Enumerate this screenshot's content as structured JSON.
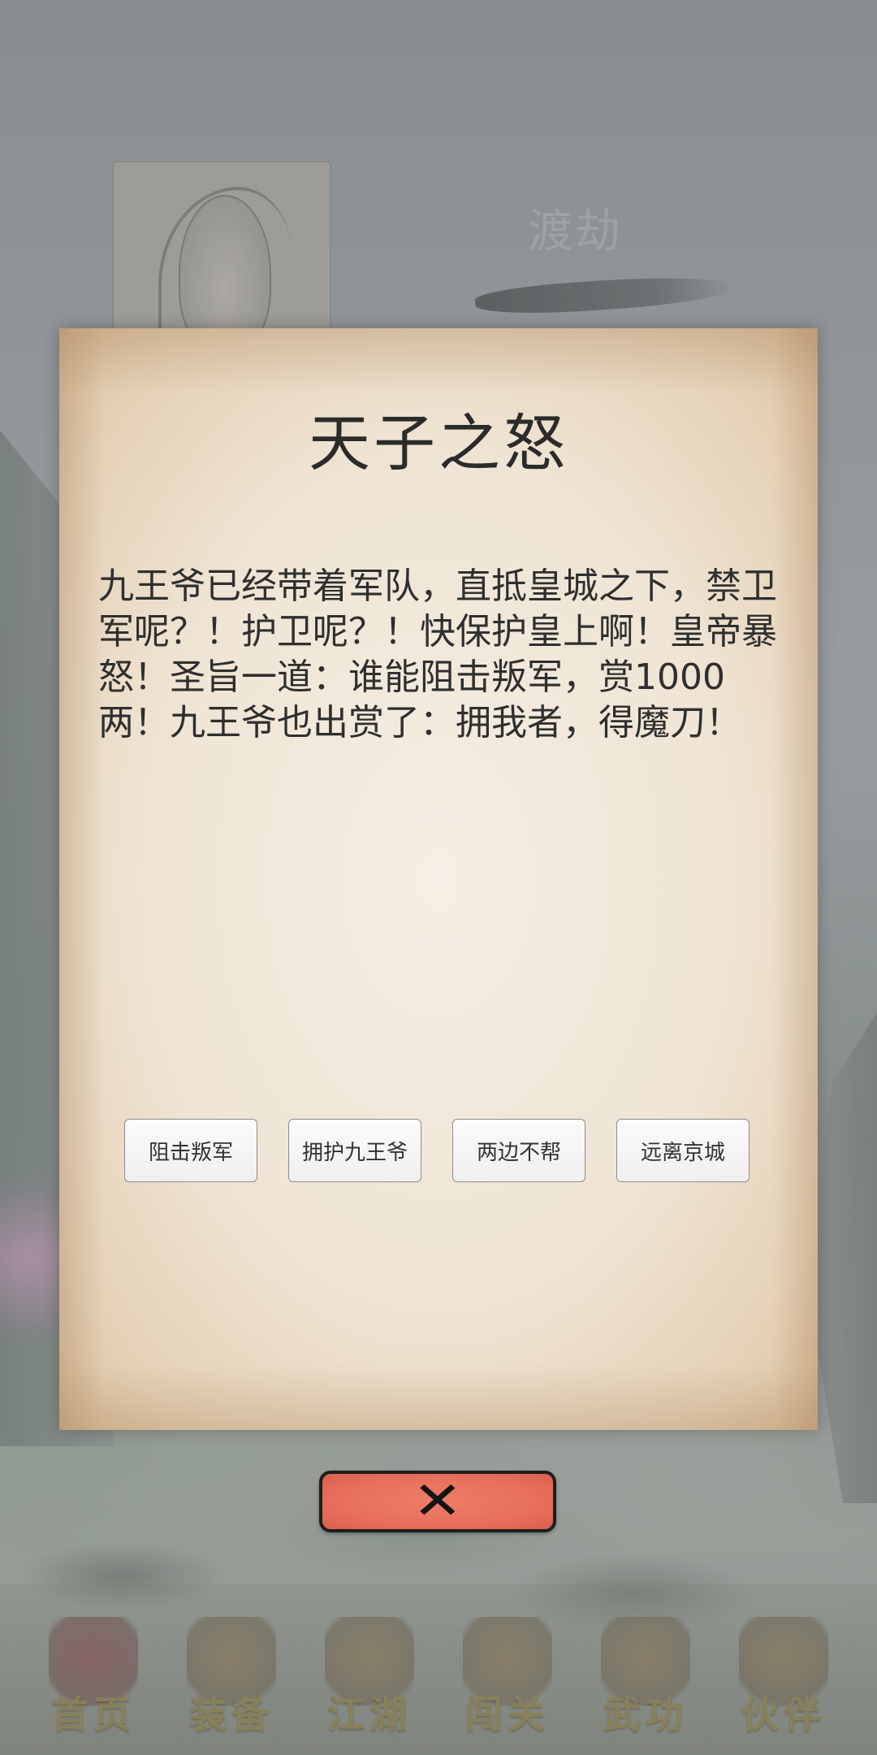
{
  "background": {
    "stage_title": "渡劫"
  },
  "dialog": {
    "title": "天子之怒",
    "body": "九王爷已经带着军队，直抵皇城之下，禁卫军呢？！护卫呢？！快保护皇上啊！皇帝暴怒！圣旨一道：谁能阻击叛军，赏1000两！九王爷也出赏了：拥我者，得魔刀！",
    "choices": [
      {
        "label": "阻击叛军"
      },
      {
        "label": "拥护九王爷"
      },
      {
        "label": "两边不帮"
      },
      {
        "label": "远离京城"
      }
    ]
  },
  "close_button": {
    "icon": "close-icon",
    "color": "#e8705c"
  },
  "bottom_nav": {
    "items": [
      {
        "label": "首页",
        "icon": "home-icon"
      },
      {
        "label": "装备",
        "icon": "armor-icon"
      },
      {
        "label": "江湖",
        "icon": "scroll-icon"
      },
      {
        "label": "闯关",
        "icon": "book-icon"
      },
      {
        "label": "武功",
        "icon": "manual-icon"
      },
      {
        "label": "伙伴",
        "icon": "partners-icon"
      }
    ]
  }
}
